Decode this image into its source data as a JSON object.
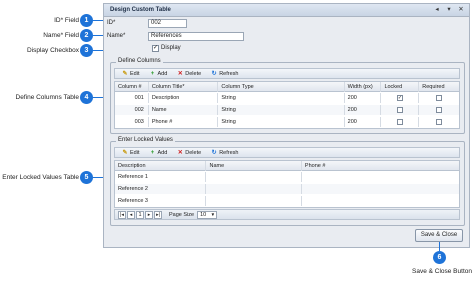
{
  "callouts": [
    {
      "n": "1",
      "label": "ID* Field"
    },
    {
      "n": "2",
      "label": "Name* Field"
    },
    {
      "n": "3",
      "label": "Display Checkbox"
    },
    {
      "n": "4",
      "label": "Define Columns Table"
    },
    {
      "n": "5",
      "label": "Enter Locked Values Table"
    },
    {
      "n": "6",
      "label": "Save & Close Button"
    }
  ],
  "dialog": {
    "title": "Design Custom Table",
    "controls": [
      "◂",
      "▾",
      "✕"
    ]
  },
  "form": {
    "id_label": "ID*",
    "id_value": "002",
    "name_label": "Name*",
    "name_value": "References",
    "display_label": "Display",
    "display_checked": "✓"
  },
  "define_columns": {
    "group_title": "Define Columns",
    "toolbar": {
      "edit": "Edit",
      "add": "Add",
      "delete": "Delete",
      "refresh": "Refresh"
    },
    "headers": [
      "Column #",
      "Column Title*",
      "Column Type",
      "Width (px)",
      "Locked",
      "Required"
    ],
    "rows": [
      {
        "num": "001",
        "title": "Description",
        "type": "String",
        "width": "200",
        "locked": "✓",
        "required": ""
      },
      {
        "num": "002",
        "title": "Name",
        "type": "String",
        "width": "200",
        "locked": "",
        "required": ""
      },
      {
        "num": "003",
        "title": "Phone #",
        "type": "String",
        "width": "200",
        "locked": "",
        "required": ""
      }
    ]
  },
  "locked_values": {
    "group_title": "Enter Locked Values",
    "toolbar": {
      "edit": "Edit",
      "add": "Add",
      "delete": "Delete",
      "refresh": "Refresh"
    },
    "headers": [
      "Description",
      "Name",
      "Phone #"
    ],
    "rows": [
      {
        "description": "Reference 1",
        "name": "",
        "phone": ""
      },
      {
        "description": "Reference 2",
        "name": "",
        "phone": ""
      },
      {
        "description": "Reference 3",
        "name": "",
        "phone": ""
      }
    ],
    "pager": {
      "first": "|◂",
      "prev": "◂",
      "page": "1",
      "next": "▸",
      "last": "▸|",
      "page_size_label": "Page Size",
      "page_size": "10"
    }
  },
  "save_button": "Save & Close",
  "colors": {
    "marker": "#1e73d8",
    "dialog_bg": "#e9ecf1"
  }
}
